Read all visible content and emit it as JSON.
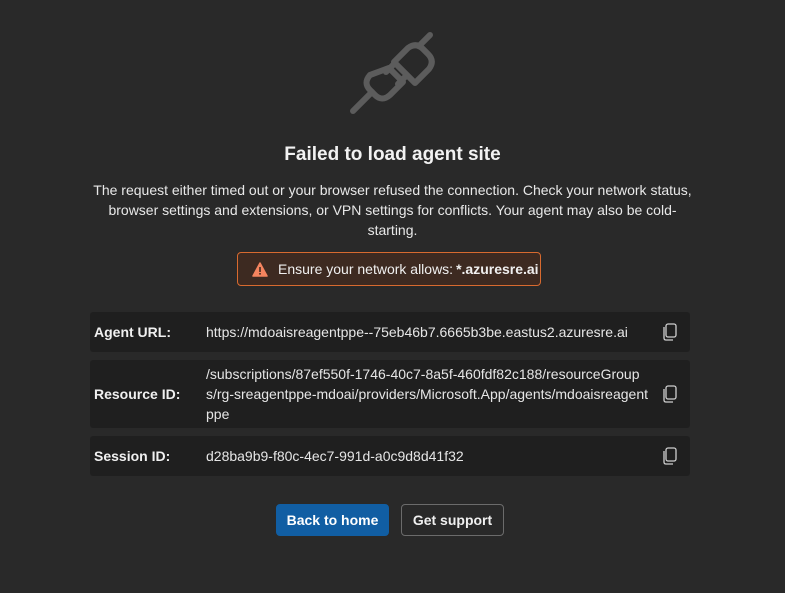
{
  "error": {
    "icon": "unplugged-icon",
    "title": "Failed to load agent site",
    "description": "The request either timed out or your browser refused the connection. Check your network status, browser settings and extensions, or VPN settings for conflicts. Your agent may also be cold-starting."
  },
  "warning": {
    "icon": "warning-icon",
    "text": "Ensure your network allows:",
    "host": "*.azuresre.ai",
    "color": "#d86a2f"
  },
  "details": [
    {
      "label": "Agent URL:",
      "value": "https://mdoaisreagentppe--75eb46b7.6665b3be.eastus2.azuresre.ai",
      "icon": "copy-icon"
    },
    {
      "label": "Resource ID:",
      "value": "/subscriptions/87ef550f-1746-40c7-8a5f-460fdf82c188/resourceGroups/rg-sreagentppe-mdoai/providers/Microsoft.App/agents/mdoaisreagentppe",
      "icon": "copy-icon"
    },
    {
      "label": "Session ID:",
      "value": "d28ba9b9-f80c-4ec7-991d-a0c9d8d41f32",
      "icon": "copy-icon"
    }
  ],
  "actions": {
    "back_label": "Back to home",
    "support_label": "Get support",
    "primary_color": "#115ea3"
  }
}
